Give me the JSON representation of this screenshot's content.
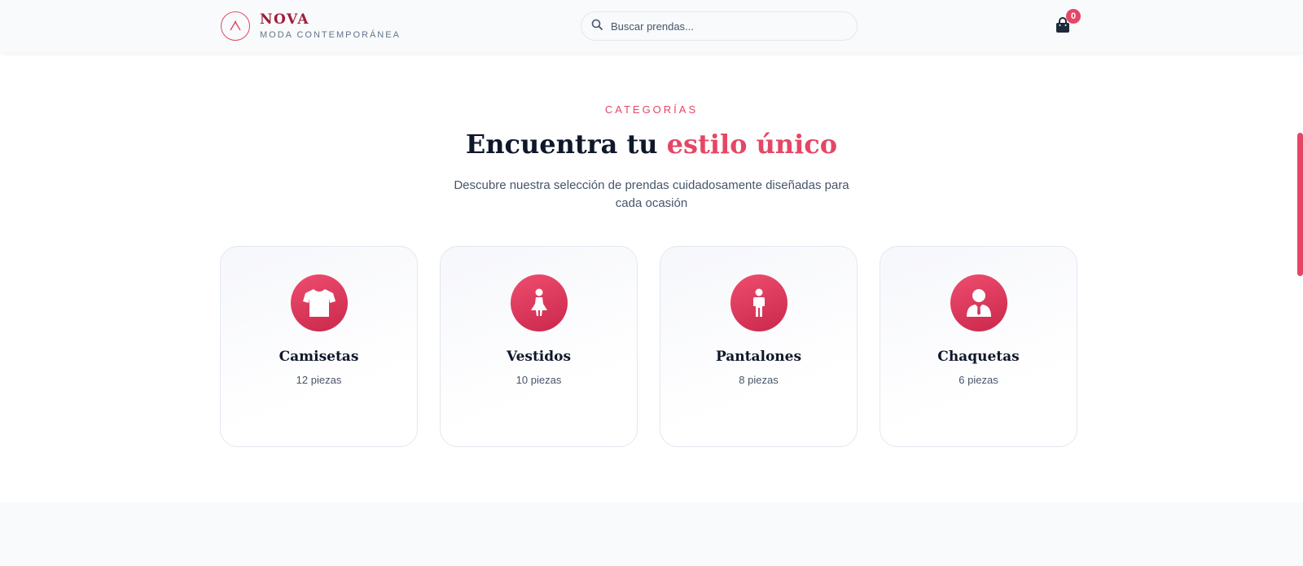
{
  "header": {
    "brand_name": "NOVA",
    "brand_tagline": "MODA CONTEMPORÁNEA",
    "search_placeholder": "Buscar prendas...",
    "cart_count": "0"
  },
  "categories": {
    "eyebrow": "CATEGORÍAS",
    "title_main": "Encuentra tu",
    "title_accent": "estilo único",
    "subtitle": "Descubre nuestra selección de prendas cuidadosamente diseñadas para cada ocasión",
    "items": [
      {
        "name": "Camisetas",
        "count": "12 piezas",
        "icon": "tshirt-icon"
      },
      {
        "name": "Vestidos",
        "count": "10 piezas",
        "icon": "dress-icon"
      },
      {
        "name": "Pantalones",
        "count": "8 piezas",
        "icon": "pants-icon"
      },
      {
        "name": "Chaquetas",
        "count": "6 piezas",
        "icon": "jacket-icon"
      }
    ]
  },
  "colors": {
    "accent": "#e54666",
    "accent_dark": "#9f1d3a",
    "text": "#0f172a",
    "muted": "#475569"
  }
}
